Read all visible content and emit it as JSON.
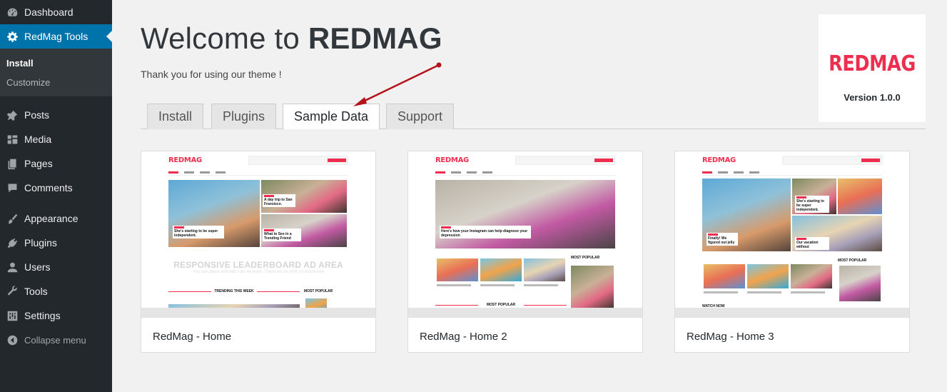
{
  "sidebar": {
    "items": [
      {
        "label": "Dashboard",
        "icon": "dashboard-icon"
      },
      {
        "label": "RedMag Tools",
        "icon": "gear-icon",
        "active": true
      },
      {
        "label": "Posts",
        "icon": "pin-icon"
      },
      {
        "label": "Media",
        "icon": "media-icon"
      },
      {
        "label": "Pages",
        "icon": "pages-icon"
      },
      {
        "label": "Comments",
        "icon": "comments-icon"
      },
      {
        "label": "Appearance",
        "icon": "brush-icon"
      },
      {
        "label": "Plugins",
        "icon": "plug-icon"
      },
      {
        "label": "Users",
        "icon": "user-icon"
      },
      {
        "label": "Tools",
        "icon": "wrench-icon"
      },
      {
        "label": "Settings",
        "icon": "settings-icon"
      }
    ],
    "submenu": [
      {
        "label": "Install",
        "current": true
      },
      {
        "label": "Customize"
      }
    ],
    "collapse_label": "Collapse menu"
  },
  "header": {
    "title_prefix": "Welcome to ",
    "title_brand": "REDMAG",
    "subtitle": "Thank you for using our theme !"
  },
  "badge": {
    "logo": "REDMAG",
    "version": "Version 1.0.0"
  },
  "tabs": [
    {
      "label": "Install"
    },
    {
      "label": "Plugins"
    },
    {
      "label": "Sample Data",
      "active": true
    },
    {
      "label": "Support"
    }
  ],
  "demos": [
    {
      "label": "RedMag - Home",
      "preview": {
        "logo": "REDMAG",
        "caption_1": "She's starting to be super independent.",
        "caption_2": "A day trip to San Fransisco.",
        "caption_3": "What to See in a Trending Friend",
        "ad_title": "RESPONSIVE LEADERBOARD AD AREA",
        "ad_sub": "You can place and edit it as we want. There are no limit of responsive",
        "section_1": "TRENDING THIS WEEK",
        "section_2": "MOST POPULAR"
      }
    },
    {
      "label": "RedMag - Home 2",
      "preview": {
        "logo": "REDMAG",
        "caption_1": "Here's how your Instagram can help diagnose your depression",
        "section_1": "MOST POPULAR",
        "section_2": "MOST POPULAR"
      }
    },
    {
      "label": "RedMag - Home 3",
      "preview": {
        "logo": "REDMAG",
        "caption_1": "Finally! We figured out jelly",
        "caption_2": "She's starting to be super independent.",
        "caption_3": "Our vacation without",
        "section_1": "WATCH NOW",
        "section_2": "MOST POPULAR"
      }
    }
  ],
  "colors": {
    "sidebar_bg": "#23282d",
    "active_menu": "#0073aa",
    "brand_red": "#ee2e4f",
    "arrow": "#b5121b"
  }
}
